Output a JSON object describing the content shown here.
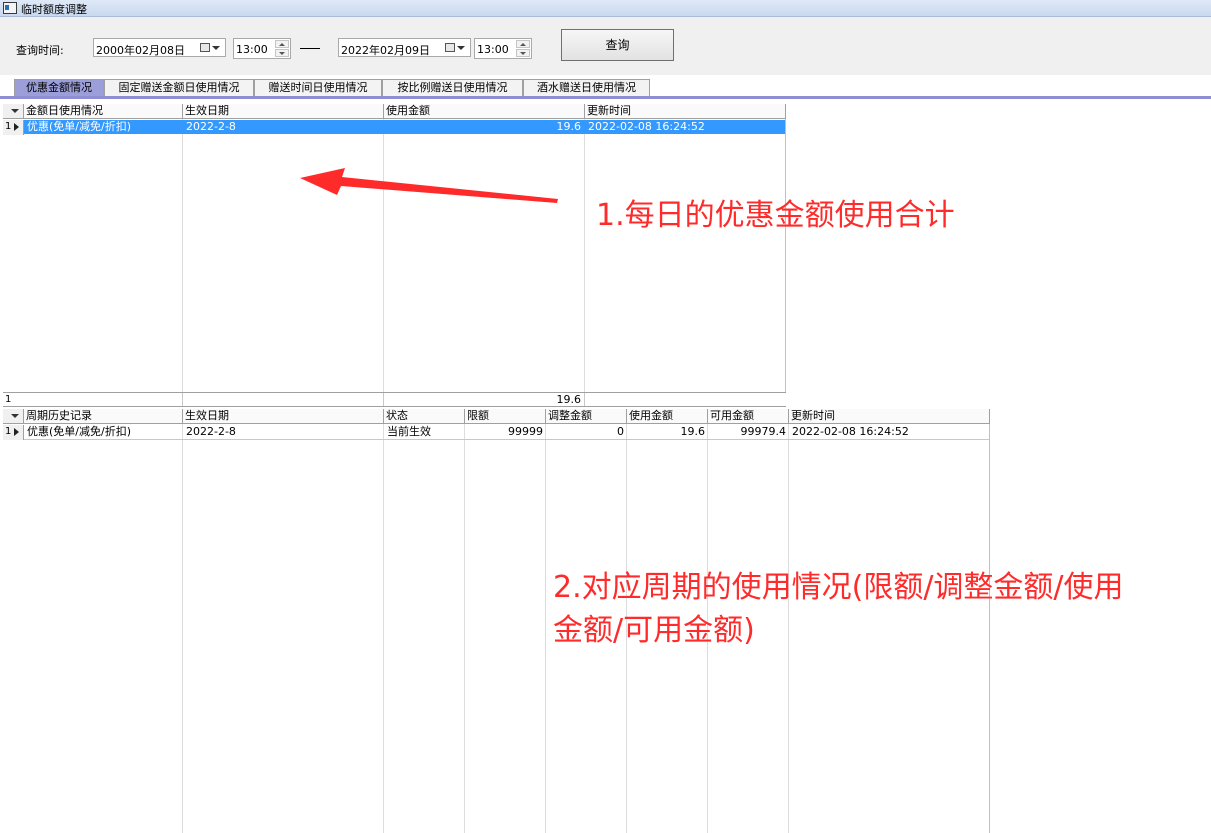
{
  "window": {
    "title": "临时额度调整"
  },
  "query": {
    "label": "查询时间:",
    "start_date": "2000年02月08日",
    "start_time": "13:00",
    "end_date": "2022年02月09日",
    "end_time": "13:00",
    "button": "查询"
  },
  "tabs": [
    {
      "label": "优惠金额情况",
      "active": true
    },
    {
      "label": "固定赠送金额日使用情况"
    },
    {
      "label": "赠送时间日使用情况"
    },
    {
      "label": "按比例赠送日使用情况"
    },
    {
      "label": "酒水赠送日使用情况"
    }
  ],
  "daily_grid": {
    "columns": [
      "金额日使用情况",
      "生效日期",
      "使用金额",
      "更新时间"
    ],
    "rows": [
      {
        "num": "1",
        "cells": [
          "优惠(免单/减免/折扣)",
          "2022-2-8",
          "19.6",
          "2022-02-08 16:24:52"
        ]
      }
    ],
    "footer": {
      "num": "1",
      "total": "19.6"
    }
  },
  "period_grid": {
    "columns": [
      "周期历史记录",
      "生效日期",
      "状态",
      "限额",
      "调整金额",
      "使用金额",
      "可用金额",
      "更新时间"
    ],
    "rows": [
      {
        "num": "1",
        "cells": [
          "优惠(免单/减免/折扣)",
          "2022-2-8",
          "当前生效",
          "99999",
          "0",
          "19.6",
          "99979.4",
          "2022-02-08 16:24:52"
        ]
      }
    ]
  },
  "annotations": {
    "a1": "1.每日的优惠金额使用合计",
    "a2_line1": "2.对应周期的使用情况(限额/调整金额/使用",
    "a2_line2": "金额/可用金额)"
  },
  "colors": {
    "selection": "#3399ff",
    "annotation": "#ff2b2b",
    "tab_active": "#9b9ed8"
  }
}
